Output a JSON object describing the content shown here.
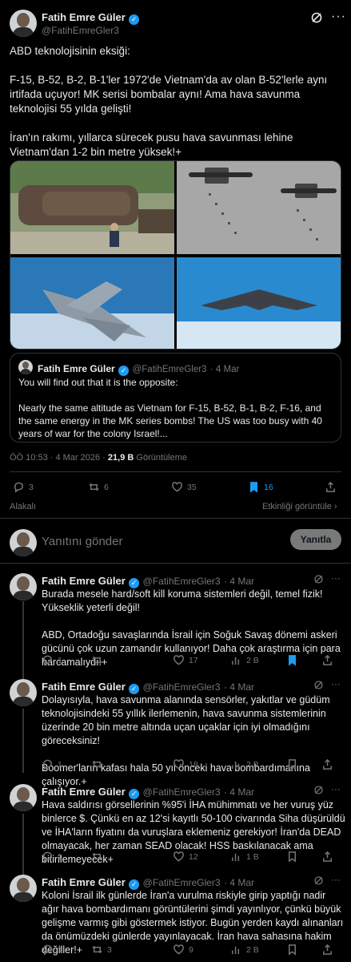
{
  "author": {
    "name": "Fatih Emre Güler",
    "handle": "@FatihEmreGler3"
  },
  "main": {
    "text": "ABD teknolojisinin eksiği:\n\nF-15, B-52, B-2, B-1'ler 1972'de Vietnam'da av olan B-52'lerle aynı irtifada uçuyor! MK serisi bombalar aynı! Ama hava savunma teknolojisi 55 yılda gelişti!\n\nİran'ın rakımı, yıllarca sürecek pusu hava savunması lehine Vietnam'dan 1-2 bin metre yüksek!+",
    "images": [
      "aircraft wreck",
      "b52 bombing",
      "f15 jet",
      "b2 bomber"
    ],
    "quote": {
      "name": "Fatih Emre Güler",
      "handle": "@FatihEmreGler3",
      "date": "· 4 Mar",
      "text": "You will find out that it is the opposite:\n\nNearly the same altitude as Vietnam for F-15, B-52, B-1, B-2, F-16, and the same energy in the MK series bombs! The US was too busy with 40 years of war for the colony Israel!..."
    },
    "time": "ÖÖ 10:53 · 4 Mar 2026 ·",
    "views_count": "21,9 B",
    "views_label": "Görüntüleme",
    "stats": {
      "replies": "3",
      "reposts": "6",
      "likes": "35",
      "bookmarks": "16"
    },
    "related_label": "Alakalı",
    "engagement_label": "Etkinliği görüntüle"
  },
  "reply_box": {
    "placeholder": "Yanıtını gönder",
    "button": "Yanıtla"
  },
  "replies": [
    {
      "date": "· 4 Mar",
      "text": "Burada mesele hard/soft kill koruma sistemleri değil, temel fizik! Yükseklik yeterli değil!\n\nABD, Ortadoğu savaşlarında İsrail için Soğuk Savaş dönemi askeri gücünü çok uzun zamandır kullanıyor! Daha çok araştırma için para harcamalıydı!+",
      "replies": "1",
      "reposts": "",
      "likes": "17",
      "views": "2 B"
    },
    {
      "date": "· 4 Mar",
      "text": "Dolayısıyla, hava savunma alanında sensörler, yakıtlar ve güdüm teknolojisindeki 55 yıllık ilerlemenin, hava savunma sistemlerinin üzerinde 20 bin metre altında uçan uçaklar için iyi olmadığını göreceksiniz!\n\nBoomer'ların kafası hala 50 yıl önceki hava bombardımanına çalışıyor.+",
      "replies": "1",
      "reposts": "",
      "likes": "18",
      "views": "2 B"
    },
    {
      "date": "· 4 Mar",
      "text": "Hava saldırısı görsellerinin %95'i İHA mühimmatı ve her vuruş yüz binlerce $. Çünkü en az 12'si kayıtlı 50-100 civarında Siha düşürüldü ve İHA'ların fiyatını da vuruşlara eklemeniz gerekiyor! İran'da DEAD olmayacak, her zaman SEAD olacak! HSS baskılanacak ama bitirilemeyecek+",
      "replies": "1",
      "reposts": "",
      "likes": "12",
      "views": "1 B"
    },
    {
      "date": "· 4 Mar",
      "text": "Koloni İsrail ilk günlerde İran'a vurulma riskiyle girip yaptığı nadir ağır hava bombardımanı görüntülerini şimdi yayınlıyor, çünkü büyük gelişme varmış gibi göstermek istiyor. Bugün yerden kaydı alınanları da önümüzdeki günlerde yayınlayacak. İran hava sahasına hakim değiller!+",
      "replies": "1",
      "reposts": "3",
      "likes": "9",
      "views": "2 B"
    }
  ],
  "colors": {
    "accent": "#1d9bf0",
    "bg": "#000000",
    "muted": "#71767b",
    "text": "#e7e9ea",
    "border": "#2f3336"
  }
}
